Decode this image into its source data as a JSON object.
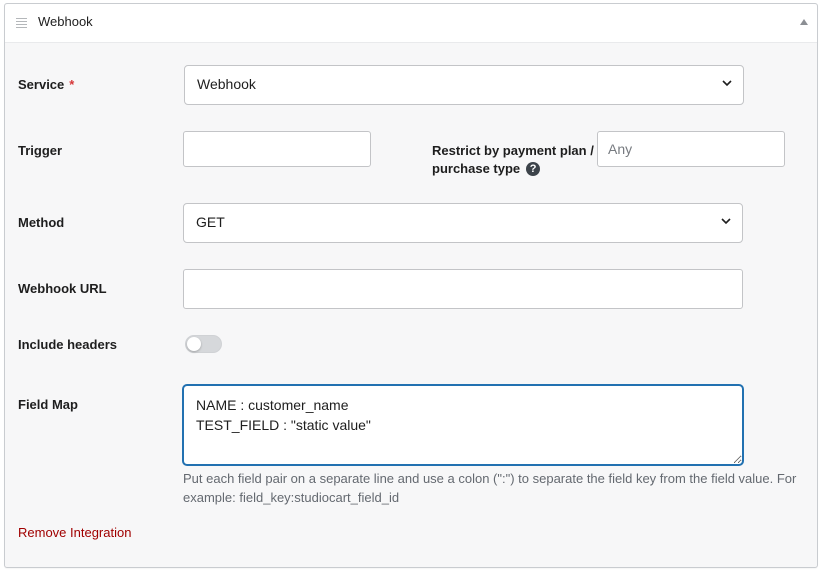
{
  "header": {
    "title": "Webhook"
  },
  "service": {
    "label": "Service",
    "required_mark": "*",
    "value": "Webhook"
  },
  "trigger": {
    "label": "Trigger",
    "value": ""
  },
  "restrict": {
    "label": "Restrict by payment plan / purchase type",
    "placeholder": "Any",
    "help_glyph": "?"
  },
  "method": {
    "label": "Method",
    "value": "GET"
  },
  "webhook_url": {
    "label": "Webhook URL",
    "value": ""
  },
  "include_headers": {
    "label": "Include headers",
    "enabled": false
  },
  "field_map": {
    "label": "Field Map",
    "value": "NAME : customer_name\nTEST_FIELD : \"static value\"",
    "hint": "Put each field pair on a separate line and use a colon (\":\") to separate the field key from the field value. For example: field_key:studiocart_field_id"
  },
  "remove": {
    "label": "Remove Integration"
  },
  "colors": {
    "link": "#a00000",
    "required": "#d63638",
    "focus": "#2271b1"
  }
}
